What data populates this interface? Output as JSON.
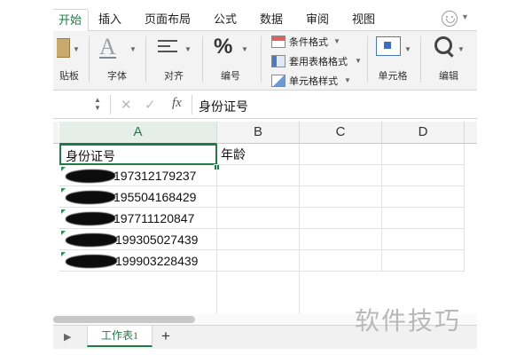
{
  "ribbon": {
    "tabs": [
      "开始",
      "插入",
      "页面布局",
      "公式",
      "数据",
      "审阅",
      "视图"
    ],
    "groups": {
      "paste": "贴板",
      "font": "字体",
      "align": "对齐",
      "number": "编号",
      "cells": "单元格",
      "edit": "编辑"
    },
    "format_items": [
      "条件格式",
      "套用表格格式",
      "单元格样式"
    ]
  },
  "formula_bar": {
    "fx": "fx",
    "content": "身份证号"
  },
  "columns": [
    "A",
    "B",
    "C",
    "D"
  ],
  "cells": {
    "a1": "身份证号",
    "b1": "年龄",
    "ids": [
      "197312179237",
      "195504168429",
      "197711120847",
      "199305027439",
      "199903228439"
    ]
  },
  "sheet": {
    "tab": "工作表1",
    "add": "+"
  },
  "watermark": "软件技巧",
  "colors": {
    "accent": "#1f7a45"
  }
}
